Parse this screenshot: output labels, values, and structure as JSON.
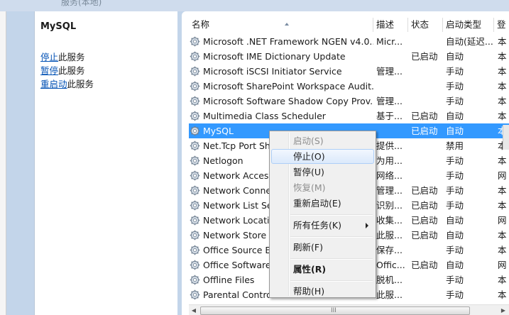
{
  "window": {
    "title_fragment": "服务(本地)"
  },
  "left_pane": {
    "service_name": "MySQL",
    "actions": [
      {
        "link": "停止",
        "suffix": "此服务"
      },
      {
        "link": "暂停",
        "suffix": "此服务"
      },
      {
        "link": "重启动",
        "suffix": "此服务"
      }
    ]
  },
  "columns": [
    "名称",
    "描述",
    "状态",
    "启动类型",
    "登"
  ],
  "services": [
    {
      "name": "Microsoft .NET Framework NGEN v4.0...",
      "desc": "Micr...",
      "status": "",
      "startup": "自动(延迟...",
      "logon": "本"
    },
    {
      "name": "Microsoft IME Dictionary Update",
      "desc": "",
      "status": "已启动",
      "startup": "自动",
      "logon": "本"
    },
    {
      "name": "Microsoft iSCSI Initiator Service",
      "desc": "管理...",
      "status": "",
      "startup": "手动",
      "logon": "本"
    },
    {
      "name": "Microsoft SharePoint Workspace Audit...",
      "desc": "",
      "status": "",
      "startup": "手动",
      "logon": "本"
    },
    {
      "name": "Microsoft Software Shadow Copy Prov...",
      "desc": "管理...",
      "status": "",
      "startup": "手动",
      "logon": "本"
    },
    {
      "name": "Multimedia Class Scheduler",
      "desc": "基于...",
      "status": "已启动",
      "startup": "自动",
      "logon": "本"
    },
    {
      "name": "MySQL",
      "desc": "",
      "status": "已启动",
      "startup": "自动",
      "logon": "本"
    },
    {
      "name": "Net.Tcp Port Sh",
      "desc": "提供...",
      "status": "",
      "startup": "禁用",
      "logon": "本"
    },
    {
      "name": "Netlogon",
      "desc": "为用...",
      "status": "",
      "startup": "手动",
      "logon": "本"
    },
    {
      "name": "Network Access",
      "desc": "网络...",
      "status": "",
      "startup": "手动",
      "logon": "网"
    },
    {
      "name": "Network Conne",
      "desc": "管理...",
      "status": "已启动",
      "startup": "手动",
      "logon": "本"
    },
    {
      "name": "Network List Se",
      "desc": "识别...",
      "status": "已启动",
      "startup": "手动",
      "logon": "本"
    },
    {
      "name": "Network Locatio",
      "desc": "收集...",
      "status": "已启动",
      "startup": "自动",
      "logon": "网"
    },
    {
      "name": "Network Store I",
      "desc": "此服...",
      "status": "已启动",
      "startup": "自动",
      "logon": "本"
    },
    {
      "name": "Office  Source E",
      "desc": "保存...",
      "status": "",
      "startup": "手动",
      "logon": "本"
    },
    {
      "name": "Office Software",
      "desc": "Offic...",
      "status": "已启动",
      "startup": "自动",
      "logon": "网"
    },
    {
      "name": "Offline Files",
      "desc": "脱机...",
      "status": "",
      "startup": "手动",
      "logon": "本"
    },
    {
      "name": "Parental Contro",
      "desc": "此服...",
      "status": "",
      "startup": "手动",
      "logon": "本"
    }
  ],
  "context_menu": {
    "items": [
      {
        "label": "启动(S)",
        "disabled": true
      },
      {
        "label": "停止(O)",
        "highlighted": true
      },
      {
        "label": "暂停(U)"
      },
      {
        "label": "恢复(M)",
        "disabled": true
      },
      {
        "label": "重新启动(E)"
      },
      {
        "separator": true
      },
      {
        "label": "所有任务(K)",
        "submenu": true
      },
      {
        "separator": true
      },
      {
        "label": "刷新(F)"
      },
      {
        "separator": true
      },
      {
        "label": "属性(R)",
        "bold": true
      },
      {
        "separator": true
      },
      {
        "label": "帮助(H)"
      }
    ]
  },
  "scrollbar": {
    "grip": "III",
    "left_arrow": "◀",
    "right_arrow": "▶"
  },
  "colors": {
    "selection": "#3399ff",
    "link": "#0050b4",
    "menu_highlight": "#dbe9fb"
  }
}
